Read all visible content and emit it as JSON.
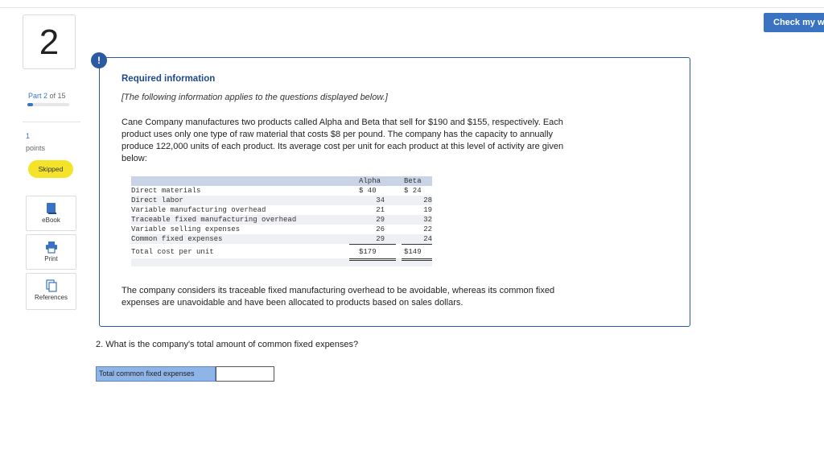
{
  "header": {
    "check_button": "Check my work"
  },
  "sidebar": {
    "question_number": "2",
    "part": {
      "prefix": "Part 2",
      "suffix": " of 15",
      "progress": 0.133
    },
    "points_value": "1",
    "points_label": "points",
    "status_badge": "Skipped",
    "tools": [
      {
        "label": "eBook",
        "icon": "book-icon"
      },
      {
        "label": "Print",
        "icon": "printer-icon"
      },
      {
        "label": "References",
        "icon": "documents-icon"
      }
    ]
  },
  "info": {
    "badge": "!",
    "title": "Required information",
    "subtitle": "[The following information applies to the questions displayed below.]",
    "para1_lines": [
      "Cane Company manufactures two products called Alpha and Beta that sell for $190 and $155, respectively. Each",
      "product uses only one type of raw material that costs $8 per pound. The company has the capacity to annually",
      "produce 122,000 units of each product. Its average cost per unit for each product at this level of activity are given",
      "below:"
    ],
    "table": {
      "col_alpha": "Alpha",
      "col_beta": "Beta",
      "rows": [
        {
          "label": "Direct materials",
          "alpha": "$ 40",
          "beta": "$ 24"
        },
        {
          "label": "Direct labor",
          "alpha": "34",
          "beta": "28"
        },
        {
          "label": "Variable manufacturing overhead",
          "alpha": "21",
          "beta": "19"
        },
        {
          "label": "Traceable fixed manufacturing overhead",
          "alpha": "29",
          "beta": "32"
        },
        {
          "label": "Variable selling expenses",
          "alpha": "26",
          "beta": "22"
        },
        {
          "label": "Common fixed expenses",
          "alpha": "29",
          "beta": "24"
        }
      ],
      "total": {
        "label": "Total cost per unit",
        "alpha": "$179",
        "beta": "$149"
      }
    },
    "para2_lines": [
      "The company considers its traceable fixed manufacturing overhead to be avoidable, whereas its common fixed",
      "expenses are unavoidable and have been allocated to products based on sales dollars."
    ]
  },
  "question": {
    "text": "2. What is the company's total amount of common fixed expenses?",
    "answer_label": "Total common fixed expenses",
    "answer_value": ""
  },
  "colors": {
    "accent": "#3a73c1",
    "info_border": "#2c5aa0",
    "badge_yellow": "#f5e32a",
    "answer_label_bg": "#8fb4e8"
  }
}
